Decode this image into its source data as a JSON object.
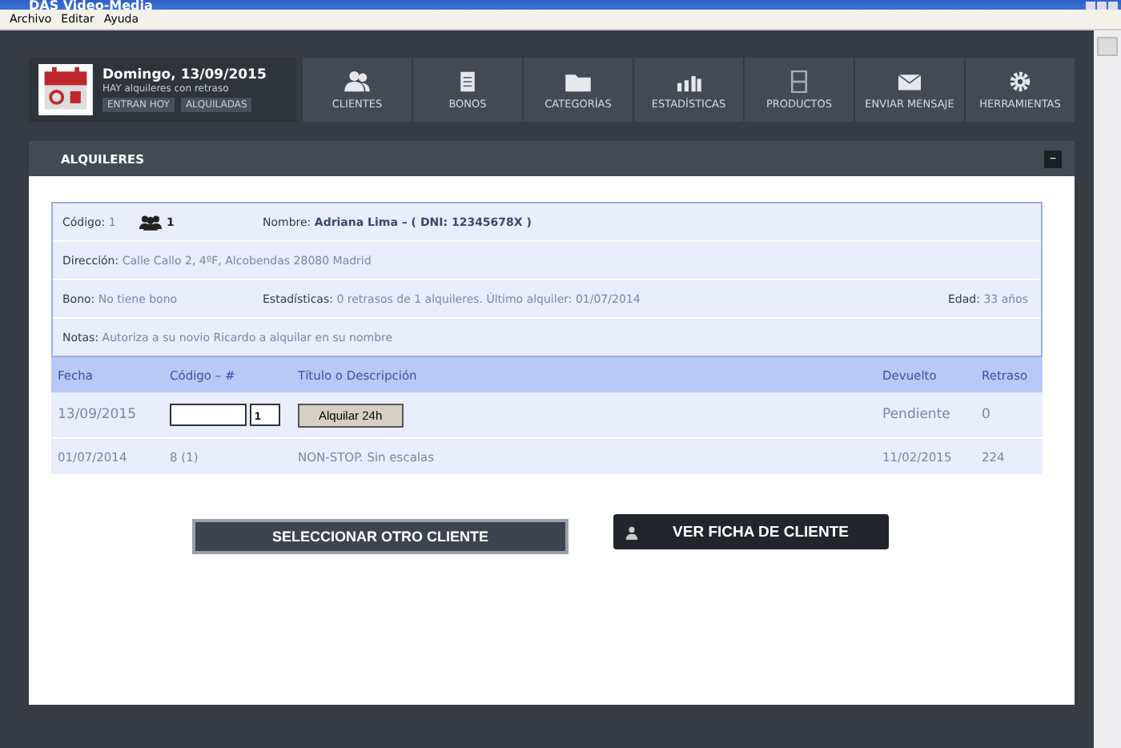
{
  "window": {
    "title": "DAS Video-Media"
  },
  "menu": [
    "Archivo",
    "Editar",
    "Ayuda"
  ],
  "date_card": {
    "date": "Domingo, 13/09/2015",
    "alert": "HAY alquileres con retraso",
    "buttons": [
      "ENTRAN HOY",
      "ALQUILADAS"
    ]
  },
  "nav": [
    {
      "label": "CLIENTES",
      "kind": "people"
    },
    {
      "label": "BONOS",
      "kind": "document"
    },
    {
      "label": "CATEGORÍAS",
      "kind": "folder"
    },
    {
      "label": "ESTADÍSTICAS",
      "kind": "bars"
    },
    {
      "label": "PRODUCTOS",
      "kind": "film"
    },
    {
      "label": "ENVIAR MENSAJE",
      "kind": "envelope"
    },
    {
      "label": "HERRAMIENTAS",
      "kind": "gear"
    }
  ],
  "panel": {
    "title": "ALQUILERES",
    "collapse": "–"
  },
  "client": {
    "codigo_label": "Código:",
    "codigo": "1",
    "group_count": "1",
    "nombre_label": "Nombre:",
    "nombre": "Adriana Lima – ( DNI: 12345678X )",
    "direccion_label": "Dirección:",
    "direccion": "Calle Callo 2, 4ºF, Alcobendas 28080 Madrid",
    "bono_label": "Bono:",
    "bono": "No tiene bono",
    "estadisticas_label": "Estadísticas:",
    "estadisticas": "0 retrasos de 1 alquileres. Último alquiler: 01/07/2014",
    "edad_label": "Edad:",
    "edad": "33 años",
    "notas_label": "Notas:",
    "notas": "Autoriza a su novio Ricardo a alquilar en su nombre"
  },
  "table": {
    "columns": [
      "Fecha",
      "Código – #",
      "Título o Descripción",
      "Devuelto",
      "Retraso"
    ],
    "rows": [
      {
        "kind": "input",
        "fecha": "13/09/2015",
        "copy": "1",
        "button": "Alquilar 24h",
        "devuelto": "Pendiente",
        "retraso": "0"
      },
      {
        "kind": "data",
        "fecha": "01/07/2014",
        "codigo": "8 (1)",
        "titulo": "NON-STOP. Sin escalas",
        "devuelto": "11/02/2015",
        "retraso": "224"
      }
    ]
  },
  "actions": [
    {
      "label": "SELECCIONAR OTRO CLIENTE",
      "kind": "plain"
    },
    {
      "label": "VER FICHA DE CLIENTE",
      "kind": "icon"
    }
  ]
}
